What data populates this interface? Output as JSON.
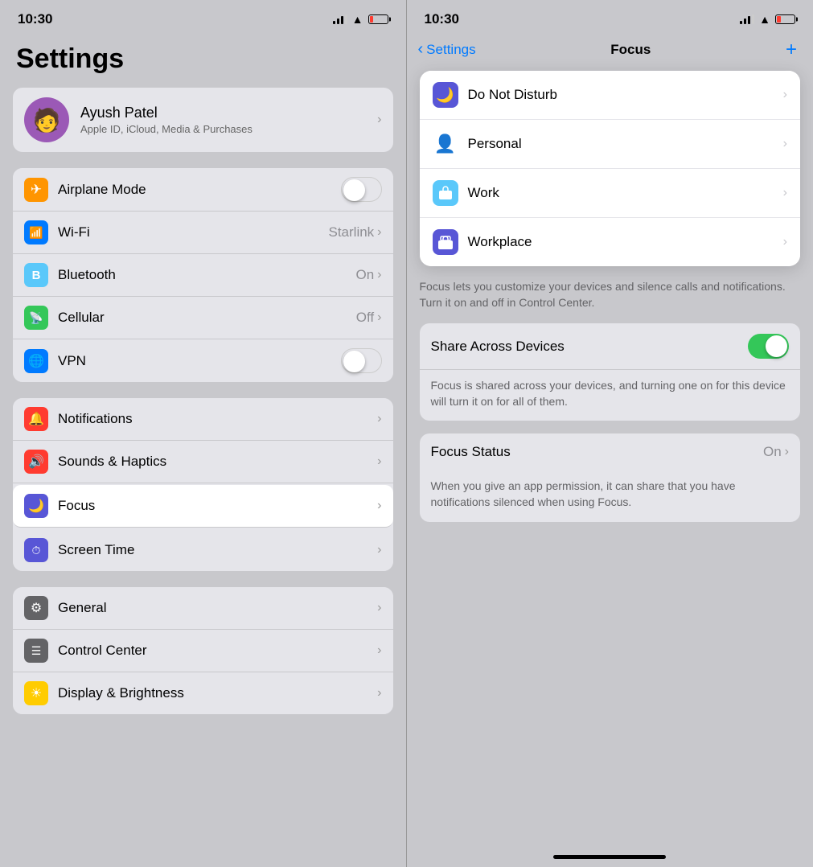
{
  "left": {
    "statusBar": {
      "time": "10:30"
    },
    "title": "Settings",
    "profile": {
      "name": "Ayush Patel",
      "sub": "Apple ID, iCloud, Media & Purchases",
      "avatar": "🧑"
    },
    "group1": [
      {
        "id": "airplane",
        "label": "Airplane Mode",
        "icon": "✈",
        "iconClass": "icon-orange",
        "control": "toggle"
      },
      {
        "id": "wifi",
        "label": "Wi-Fi",
        "icon": "📶",
        "iconClass": "icon-blue",
        "value": "Starlink",
        "control": "chevron"
      },
      {
        "id": "bluetooth",
        "label": "Bluetooth",
        "icon": "🔵",
        "iconClass": "icon-cyan",
        "value": "On",
        "control": "chevron"
      },
      {
        "id": "cellular",
        "label": "Cellular",
        "icon": "📡",
        "iconClass": "icon-green",
        "value": "Off",
        "control": "chevron"
      },
      {
        "id": "vpn",
        "label": "VPN",
        "icon": "🌐",
        "iconClass": "icon-globe",
        "control": "toggle"
      }
    ],
    "group2": [
      {
        "id": "notifications",
        "label": "Notifications",
        "icon": "🔔",
        "iconClass": "icon-red",
        "control": "chevron"
      },
      {
        "id": "sounds",
        "label": "Sounds & Haptics",
        "icon": "🔊",
        "iconClass": "icon-red2",
        "control": "chevron"
      },
      {
        "id": "focus",
        "label": "Focus",
        "icon": "🌙",
        "iconClass": "icon-purple",
        "control": "chevron",
        "highlighted": true
      },
      {
        "id": "screentime",
        "label": "Screen Time",
        "icon": "⏱",
        "iconClass": "icon-purple2",
        "control": "chevron"
      }
    ],
    "group3": [
      {
        "id": "general",
        "label": "General",
        "icon": "⚙",
        "iconClass": "icon-gray",
        "control": "chevron"
      },
      {
        "id": "controlcenter",
        "label": "Control Center",
        "icon": "☰",
        "iconClass": "icon-gray2",
        "control": "chevron"
      },
      {
        "id": "display",
        "label": "Display & Brightness",
        "icon": "☀",
        "iconClass": "icon-yellow",
        "control": "chevron"
      }
    ]
  },
  "right": {
    "statusBar": {
      "time": "10:30"
    },
    "nav": {
      "back": "Settings",
      "title": "Focus",
      "add": "+"
    },
    "focusItems": [
      {
        "id": "dnd",
        "label": "Do Not Disturb",
        "iconType": "dnd"
      },
      {
        "id": "personal",
        "label": "Personal",
        "iconType": "personal"
      },
      {
        "id": "work",
        "label": "Work",
        "iconType": "work"
      },
      {
        "id": "workplace",
        "label": "Workplace",
        "iconType": "workplace"
      }
    ],
    "focusDesc": "Focus lets you customize your devices and silence calls and notifications. Turn it on and off in Control Center.",
    "shareCard": {
      "label": "Share Across Devices",
      "sub": "Focus is shared across your devices, and turning one on for this device will turn it on for all of them."
    },
    "focusStatus": {
      "label": "Focus Status",
      "value": "On",
      "sub": "When you give an app permission, it can share that you have notifications silenced when using Focus."
    }
  }
}
